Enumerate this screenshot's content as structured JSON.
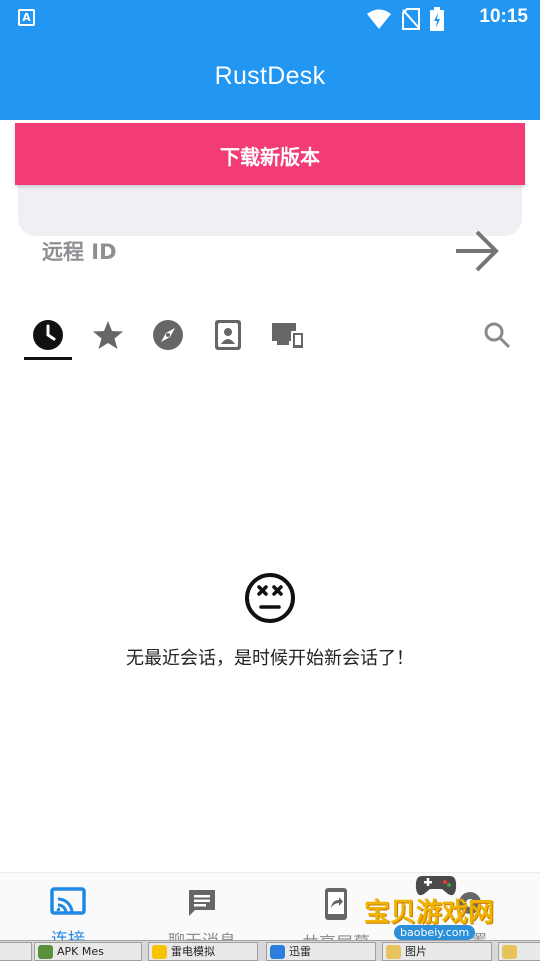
{
  "status_bar": {
    "notification_icon_text": "A",
    "time": "10:15",
    "icons": [
      "wifi-icon",
      "no-sim-icon",
      "battery-charging-icon"
    ]
  },
  "app_bar": {
    "title": "RustDesk"
  },
  "banner": {
    "download_label": "下载新版本"
  },
  "connect": {
    "remote_id_label": "远程 ID"
  },
  "tabs": [
    "recent-icon",
    "favorites-icon",
    "discovered-icon",
    "address-book-icon",
    "devices-icon"
  ],
  "empty_state": {
    "message": "无最近会话，是时候开始新会话了！"
  },
  "bottom_nav": {
    "items": [
      {
        "label": "连接",
        "icon": "cast-icon",
        "active": true
      },
      {
        "label": "聊天消息",
        "icon": "chat-icon",
        "active": false
      },
      {
        "label": "共享屏幕",
        "icon": "share-screen-icon",
        "active": false
      },
      {
        "label": "设置",
        "icon": "settings-icon",
        "active": false
      }
    ]
  },
  "watermark": {
    "title": "宝贝游戏网",
    "url": "baobeiy.com"
  },
  "taskbar": {
    "items": [
      {
        "label": "APK Mes"
      },
      {
        "label": "雷电模拟"
      },
      {
        "label": "迅雷"
      },
      {
        "label": "图片"
      }
    ]
  },
  "colors": {
    "primary": "#2196F3",
    "accent": "#F33B76",
    "active_nav": "#1E88E5"
  }
}
